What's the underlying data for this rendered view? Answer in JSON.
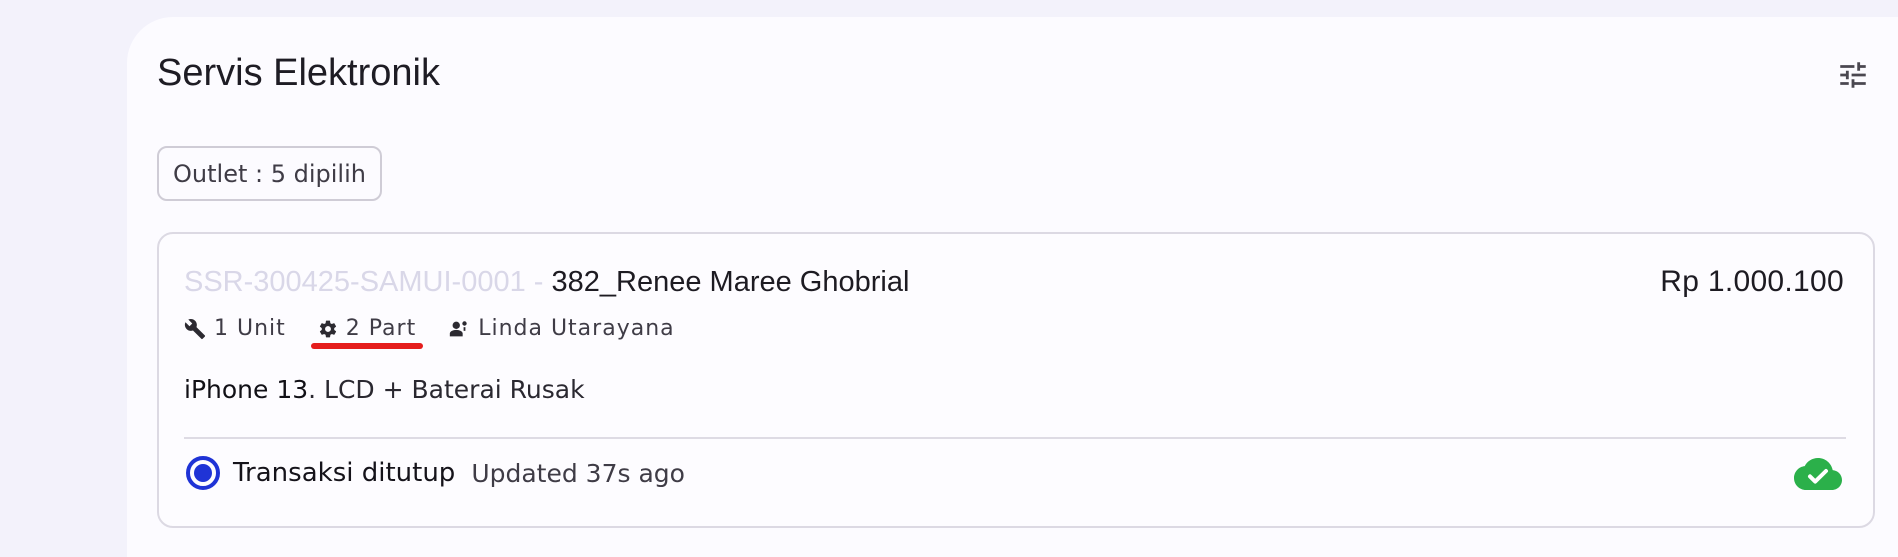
{
  "page": {
    "title": "Servis Elektronik"
  },
  "filter": {
    "outlet_label": "Outlet : 5 dipilih"
  },
  "transaction": {
    "code": "SSR-300425-SAMUI-0001",
    "separator": " - ",
    "customer": "382_Renee Maree Ghobrial",
    "price": "Rp 1.000.100",
    "units": "1 Unit",
    "parts": "2 Part",
    "technician": "Linda Utarayana",
    "device": "iPhone 13",
    "issue": ". LCD + Baterai Rusak",
    "status": "Transaksi ditutup",
    "updated": "Updated 37s ago"
  },
  "icons": {
    "filter": "tune-icon",
    "units": "wrench-icon",
    "parts": "gear-icon",
    "technician": "person-icon",
    "status": "radio-selected-icon",
    "sync": "cloud-check-icon"
  },
  "colors": {
    "accent": "#1f33d6",
    "sync_ok": "#2bb04a",
    "highlight": "#e51d1d"
  }
}
